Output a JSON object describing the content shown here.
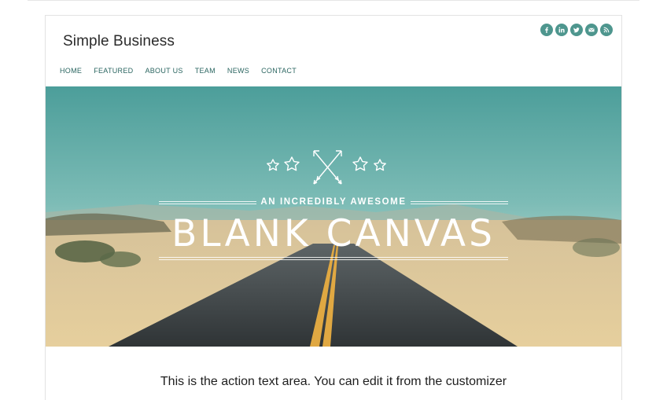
{
  "site": {
    "title": "Simple Business"
  },
  "nav": {
    "items": [
      "HOME",
      "FEATURED",
      "ABOUT US",
      "TEAM",
      "NEWS",
      "CONTACT"
    ]
  },
  "social": {
    "icons": [
      "facebook-icon",
      "linkedin-icon",
      "twitter-icon",
      "email-icon",
      "rss-icon"
    ],
    "color": "#4e968e"
  },
  "hero": {
    "kicker": "AN INCREDIBLY AWESOME",
    "headline": "BLANK CANVAS"
  },
  "action": {
    "text": "This is the action text area. You can edit it from the customizer"
  },
  "colors": {
    "accent": "#4e968e",
    "nav_text": "#2a6560"
  }
}
